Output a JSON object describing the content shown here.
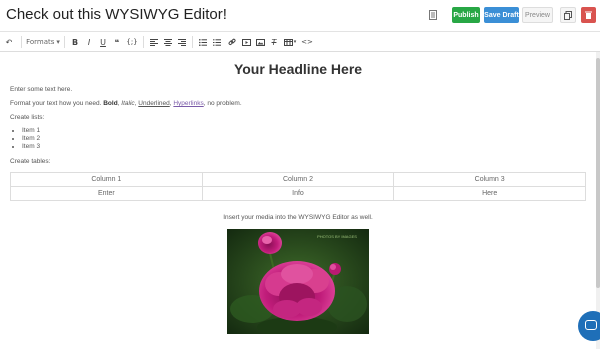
{
  "header": {
    "title": "Check out this WYSIWYG Editor!",
    "publish_label": "Publish",
    "savedraft_label": "Save Draft",
    "preview_label": "Preview",
    "icons": [
      "document-icon",
      "copy-icon",
      "trash-icon"
    ]
  },
  "toolbar": {
    "formats_label": "Formats",
    "bold": "B",
    "italic": "I",
    "underline": "U",
    "quote": "❝",
    "code": "{;}",
    "undo": "↶"
  },
  "content": {
    "headline": "Your Headline Here",
    "intro": "Enter some text here.",
    "format_prefix": "Format your text how you need.",
    "format_bold": "Bold",
    "format_italic": "Italic",
    "format_underlined": "Underlined",
    "format_hyperlinks": "Hyperlinks",
    "format_suffix": "no problem.",
    "lists_label": "Create lists:",
    "list_items": [
      "Item 1",
      "Item 2",
      "Item 3"
    ],
    "tables_label": "Create tables:",
    "table_rows": [
      [
        "Column 1",
        "Column 2",
        "Column 3"
      ],
      [
        "Enter",
        "Info",
        "Here"
      ]
    ],
    "media_text": "Insert your media into the WYSIWYG Editor as well.",
    "photo_watermark": "PHOTOS BY IMAGES"
  },
  "colors": {
    "publish": "#28a745",
    "savedraft": "#3b8fd6",
    "trash": "#d9534f",
    "link": "#7a5aa8",
    "chat": "#1f6fb8"
  }
}
